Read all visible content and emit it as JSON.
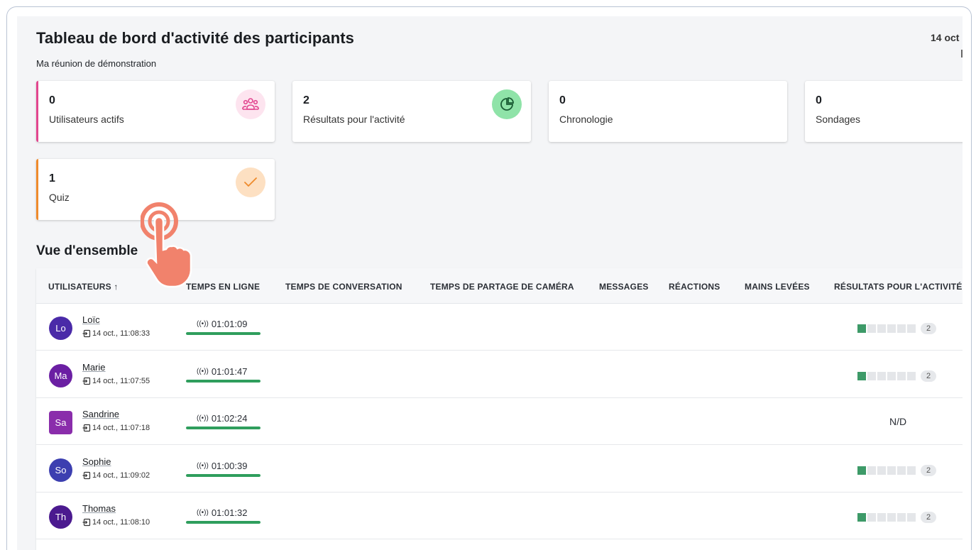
{
  "header": {
    "title": "Tableau de bord d'activité des participants",
    "subtitle": "Ma réunion de démonstration",
    "date": "14 oct"
  },
  "cards": [
    {
      "value": "0",
      "label": "Utilisateurs actifs",
      "icon": "users-icon",
      "color": "#e2468f"
    },
    {
      "value": "2",
      "label": "Résultats pour l'activité",
      "icon": "pie-chart-icon",
      "color": "#2f9e5d"
    },
    {
      "value": "0",
      "label": "Chronologie",
      "icon": "",
      "color": ""
    },
    {
      "value": "0",
      "label": "Sondages",
      "icon": "",
      "color": ""
    },
    {
      "value": "1",
      "label": "Quiz",
      "icon": "checkmark-icon",
      "color": "#ef8b2c"
    }
  ],
  "section_title": "Vue d'ensemble",
  "table": {
    "columns": [
      "UTILISATEURS ↑",
      "TEMPS EN LIGNE",
      "TEMPS DE CONVERSATION",
      "TEMPS DE PARTAGE DE CAMÉRA",
      "MESSAGES",
      "RÉACTIONS",
      "MAINS LEVÉES",
      "RÉSULTATS POUR L'ACTIVITÉ"
    ],
    "rows": [
      {
        "initials": "Lo",
        "name": "Loïc",
        "joined": "14 oct., 11:08:33",
        "online": "01:01:09",
        "online_fill": 1.0,
        "result": "2",
        "result_segments_on": 1,
        "avatar_color": "#4a2aa8"
      },
      {
        "initials": "Ma",
        "name": "Marie",
        "joined": "14 oct., 11:07:55",
        "online": "01:01:47",
        "online_fill": 1.0,
        "result": "2",
        "result_segments_on": 1,
        "avatar_color": "#6b1fa3"
      },
      {
        "initials": "Sa",
        "name": "Sandrine",
        "joined": "14 oct., 11:07:18",
        "online": "01:02:24",
        "online_fill": 1.0,
        "result": "N/D",
        "result_segments_on": 0,
        "avatar_color": "#8a2dab"
      },
      {
        "initials": "So",
        "name": "Sophie",
        "joined": "14 oct., 11:09:02",
        "online": "01:00:39",
        "online_fill": 1.0,
        "result": "2",
        "result_segments_on": 1,
        "avatar_color": "#3c3fb0"
      },
      {
        "initials": "Th",
        "name": "Thomas",
        "joined": "14 oct., 11:08:10",
        "online": "01:01:32",
        "online_fill": 1.0,
        "result": "2",
        "result_segments_on": 1,
        "avatar_color": "#4b1a8f"
      }
    ]
  },
  "overlay": {
    "icon": "tap-hand-icon",
    "color": "#f1826c"
  }
}
